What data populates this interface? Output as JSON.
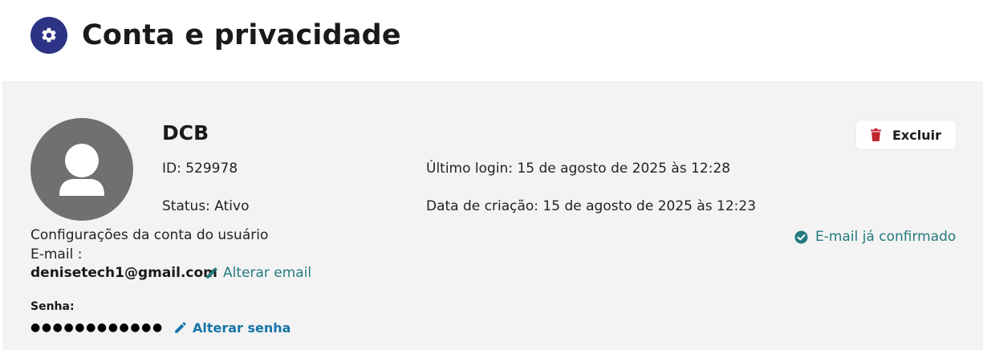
{
  "header": {
    "title": "Conta e privacidade",
    "icon": "gear-icon",
    "icon_bg": "#2d3384"
  },
  "profile": {
    "avatar_icon": "user-icon",
    "name": "DCB",
    "id_text": "ID: 529978",
    "status_text": "Status: Ativo",
    "last_login_text": "Último login: 15 de agosto de 2025 às 12:28",
    "created_text": "Data de criação: 15 de agosto de 2025 às 12:23"
  },
  "actions": {
    "delete_label": "Excluir",
    "delete_icon": "trash-icon",
    "delete_icon_color": "#c0272d"
  },
  "settings": {
    "section_title": "Configurações da conta do usuário",
    "email_label": "E-mail :",
    "email_value": "denisetech1@gmail.com",
    "email_confirmed_text": "E-mail já confirmado",
    "email_confirmed_icon": "check-circle-icon",
    "change_email_label": "Alterar email",
    "change_email_icon": "pencil-icon",
    "password_label": "Senha:",
    "password_mask": "●●●●●●●●●●●●",
    "change_password_label": "Alterar senha",
    "change_password_icon": "pencil-icon"
  },
  "colors": {
    "accent_teal": "#237a80",
    "link_blue": "#1674a8",
    "panel_bg": "#f3f3f3",
    "avatar_bg": "#707070"
  }
}
